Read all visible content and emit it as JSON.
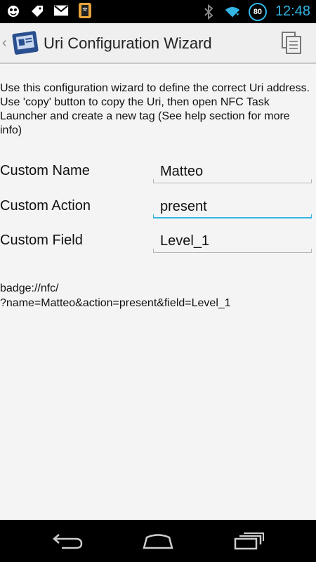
{
  "status_bar": {
    "time": "12:48",
    "battery_level": "80",
    "icons": [
      "notification-app-icon",
      "notification-tag-icon",
      "gmail-icon",
      "nfc-app-icon",
      "bluetooth-icon",
      "wifi-icon",
      "battery-icon"
    ]
  },
  "action_bar": {
    "title": "Uri Configuration Wizard",
    "copy_icon": "copy-icon"
  },
  "intro_text": "Use this configuration wizard to define the correct Uri address. Use 'copy' button to copy the Uri, then open NFC Task Launcher and create a new tag (See help section for more info)",
  "form": {
    "name_label": "Custom Name",
    "name_value": "Matteo",
    "action_label": "Custom Action",
    "action_value": "present",
    "field_label": "Custom Field",
    "field_value": "Level_1"
  },
  "uri": {
    "line1": "badge://nfc/",
    "line2": "?name=Matteo&action=present&field=Level_1"
  },
  "colors": {
    "accent": "#33b5e5",
    "content_bg": "#f4f4f4",
    "action_bar_bg": "#efefef"
  }
}
